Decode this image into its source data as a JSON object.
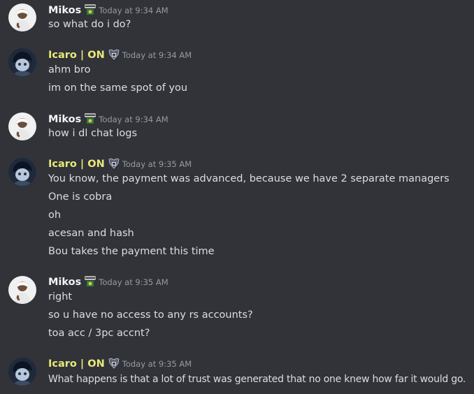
{
  "colors": {
    "background": "#313338",
    "mikos_name": "#f2f3f5",
    "icaro_name": "#e8e87a",
    "text": "#dbdee1",
    "timestamp": "#949ba4"
  },
  "messages": [
    {
      "author": "Mikos",
      "badge": "welcome-badge-icon",
      "time": "Today at 9:34 AM",
      "lines": [
        "so what do i do?"
      ]
    },
    {
      "author": "Icaro | ON",
      "badge": "emblem-badge-icon",
      "time": "Today at 9:34 AM",
      "lines": [
        "ahm bro",
        "im on the same spot of you"
      ]
    },
    {
      "author": "Mikos",
      "badge": "welcome-badge-icon",
      "time": "Today at 9:34 AM",
      "lines": [
        "how i dl chat logs"
      ]
    },
    {
      "author": "Icaro | ON",
      "badge": "emblem-badge-icon",
      "time": "Today at 9:35 AM",
      "lines": [
        "You know, the payment was advanced, because we have 2 separate managers",
        "One is cobra",
        "oh",
        "acesan and hash",
        "Bou takes the payment this time"
      ]
    },
    {
      "author": "Mikos",
      "badge": "welcome-badge-icon",
      "time": "Today at 9:35 AM",
      "lines": [
        "right",
        "so u have no access to any rs accounts?",
        "toa acc / 3pc accnt?"
      ]
    },
    {
      "author": "Icaro | ON",
      "badge": "emblem-badge-icon",
      "time": "Today at 9:35 AM",
      "lines": [
        "What happens is that a lot of trust was generated that no one knew how far it would go."
      ]
    }
  ]
}
